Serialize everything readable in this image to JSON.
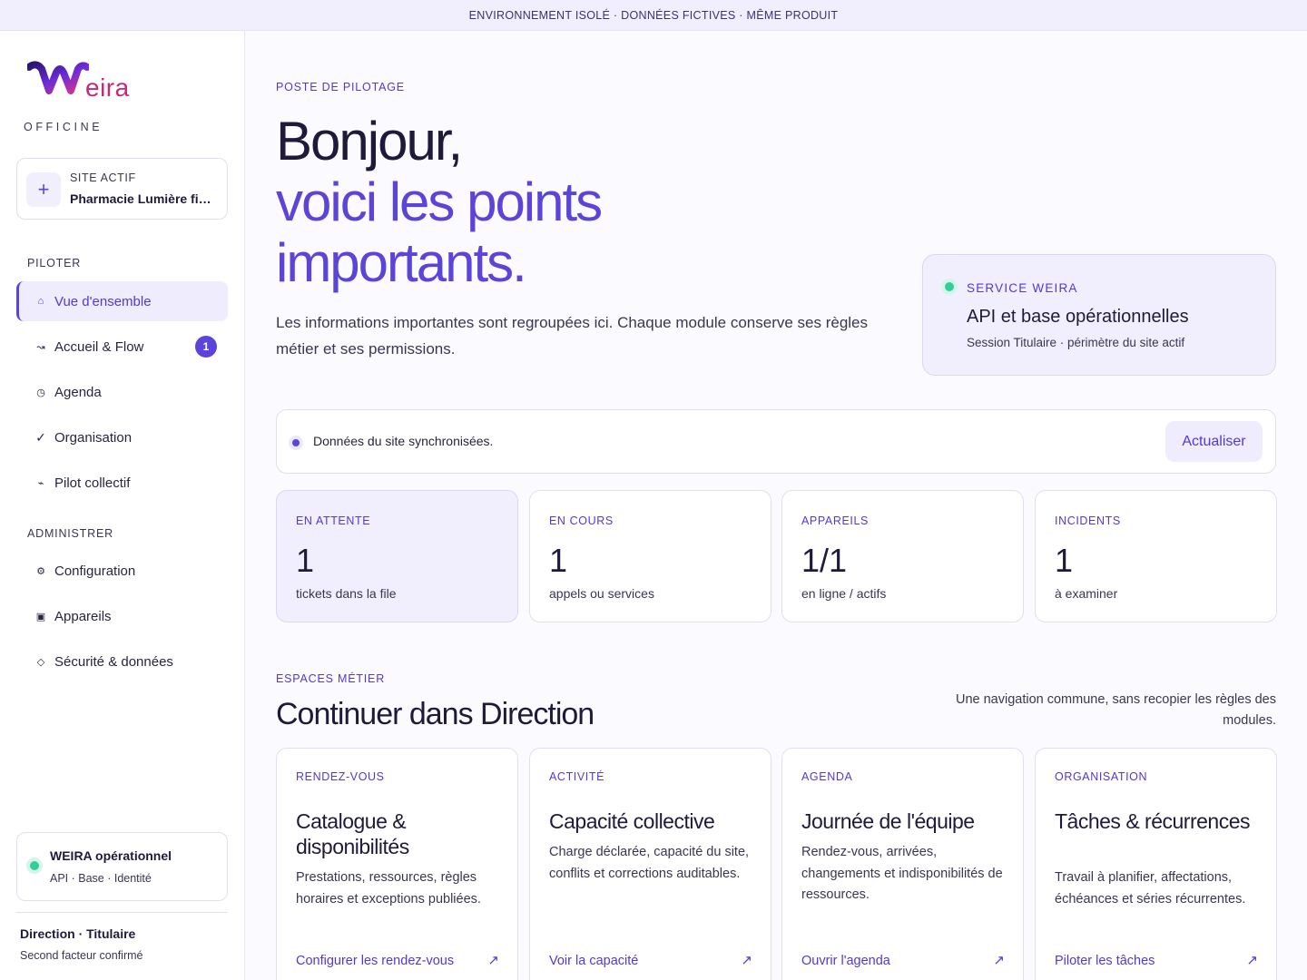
{
  "banner": "ENVIRONNEMENT ISOLÉ · DONNÉES FICTIVES · MÊME PRODUIT",
  "brand": {
    "logo_text": "eira",
    "subtitle": "OFFICINE",
    "colors": {
      "accent": "#5b45d8",
      "logo": "#c22a7a"
    }
  },
  "site": {
    "label": "SITE ACTIF",
    "name": "Pharmacie Lumière fictive",
    "icon": "plus-icon"
  },
  "nav": {
    "piloter_title": "PILOTER",
    "piloter": [
      {
        "label": "Vue d'ensemble",
        "icon": "home-icon"
      },
      {
        "label": "Accueil & Flow",
        "icon": "flow-icon",
        "badge": "1"
      },
      {
        "label": "Agenda",
        "icon": "clock-icon"
      },
      {
        "label": "Organisation",
        "icon": "check-icon"
      },
      {
        "label": "Pilot collectif",
        "icon": "pulse-icon"
      }
    ],
    "administrer_title": "ADMINISTRER",
    "administrer": [
      {
        "label": "Configuration",
        "icon": "gear-icon"
      },
      {
        "label": "Appareils",
        "icon": "device-icon"
      },
      {
        "label": "Sécurité & données",
        "icon": "diamond-icon"
      }
    ]
  },
  "status": {
    "title": "WEIRA opérationnel",
    "sub": "API · Base · Identité"
  },
  "user": {
    "name": "Direction · Titulaire",
    "sub": "Second facteur confirmé"
  },
  "hero": {
    "eyebrow": "POSTE DE PILOTAGE",
    "line1": "Bonjour,",
    "line2": "voici les points",
    "line3": "importants.",
    "lead": "Les informations importantes sont regroupées ici. Chaque module conserve ses règles métier et ses permissions."
  },
  "service": {
    "label": "SERVICE WEIRA",
    "title": "API et base opérationnelles",
    "sub": "Session Titulaire · périmètre du site actif"
  },
  "sync": {
    "text": "Données du site synchronisées.",
    "button": "Actualiser"
  },
  "stats": [
    {
      "label": "EN ATTENTE",
      "value": "1",
      "sub": "tickets dans la file"
    },
    {
      "label": "EN COURS",
      "value": "1",
      "sub": "appels ou services"
    },
    {
      "label": "APPAREILS",
      "value": "1/1",
      "sub": "en ligne / actifs"
    },
    {
      "label": "INCIDENTS",
      "value": "1",
      "sub": "à examiner"
    }
  ],
  "spaces": {
    "eyebrow": "ESPACES MÉTIER",
    "title": "Continuer dans Direction",
    "note": "Une navigation commune, sans recopier les règles des modules.",
    "cards": [
      {
        "label": "RENDEZ-VOUS",
        "title": "Catalogue & disponibilités",
        "desc": "Prestations, ressources, règles horaires et exceptions publiées.",
        "link": "Configurer les rendez-vous"
      },
      {
        "label": "ACTIVITÉ",
        "title": "Capacité collective",
        "desc": "Charge déclarée, capacité du site, conflits et corrections auditables.",
        "link": "Voir la capacité"
      },
      {
        "label": "AGENDA",
        "title": "Journée de l'équipe",
        "desc": "Rendez-vous, arrivées, changements et indisponibilités de ressources.",
        "link": "Ouvrir l'agenda"
      },
      {
        "label": "ORGANISATION",
        "title": "Tâches & récurrences",
        "desc": "Travail à planifier, affectations, échéances et séries récurrentes.",
        "link": "Piloter les tâches"
      }
    ]
  }
}
